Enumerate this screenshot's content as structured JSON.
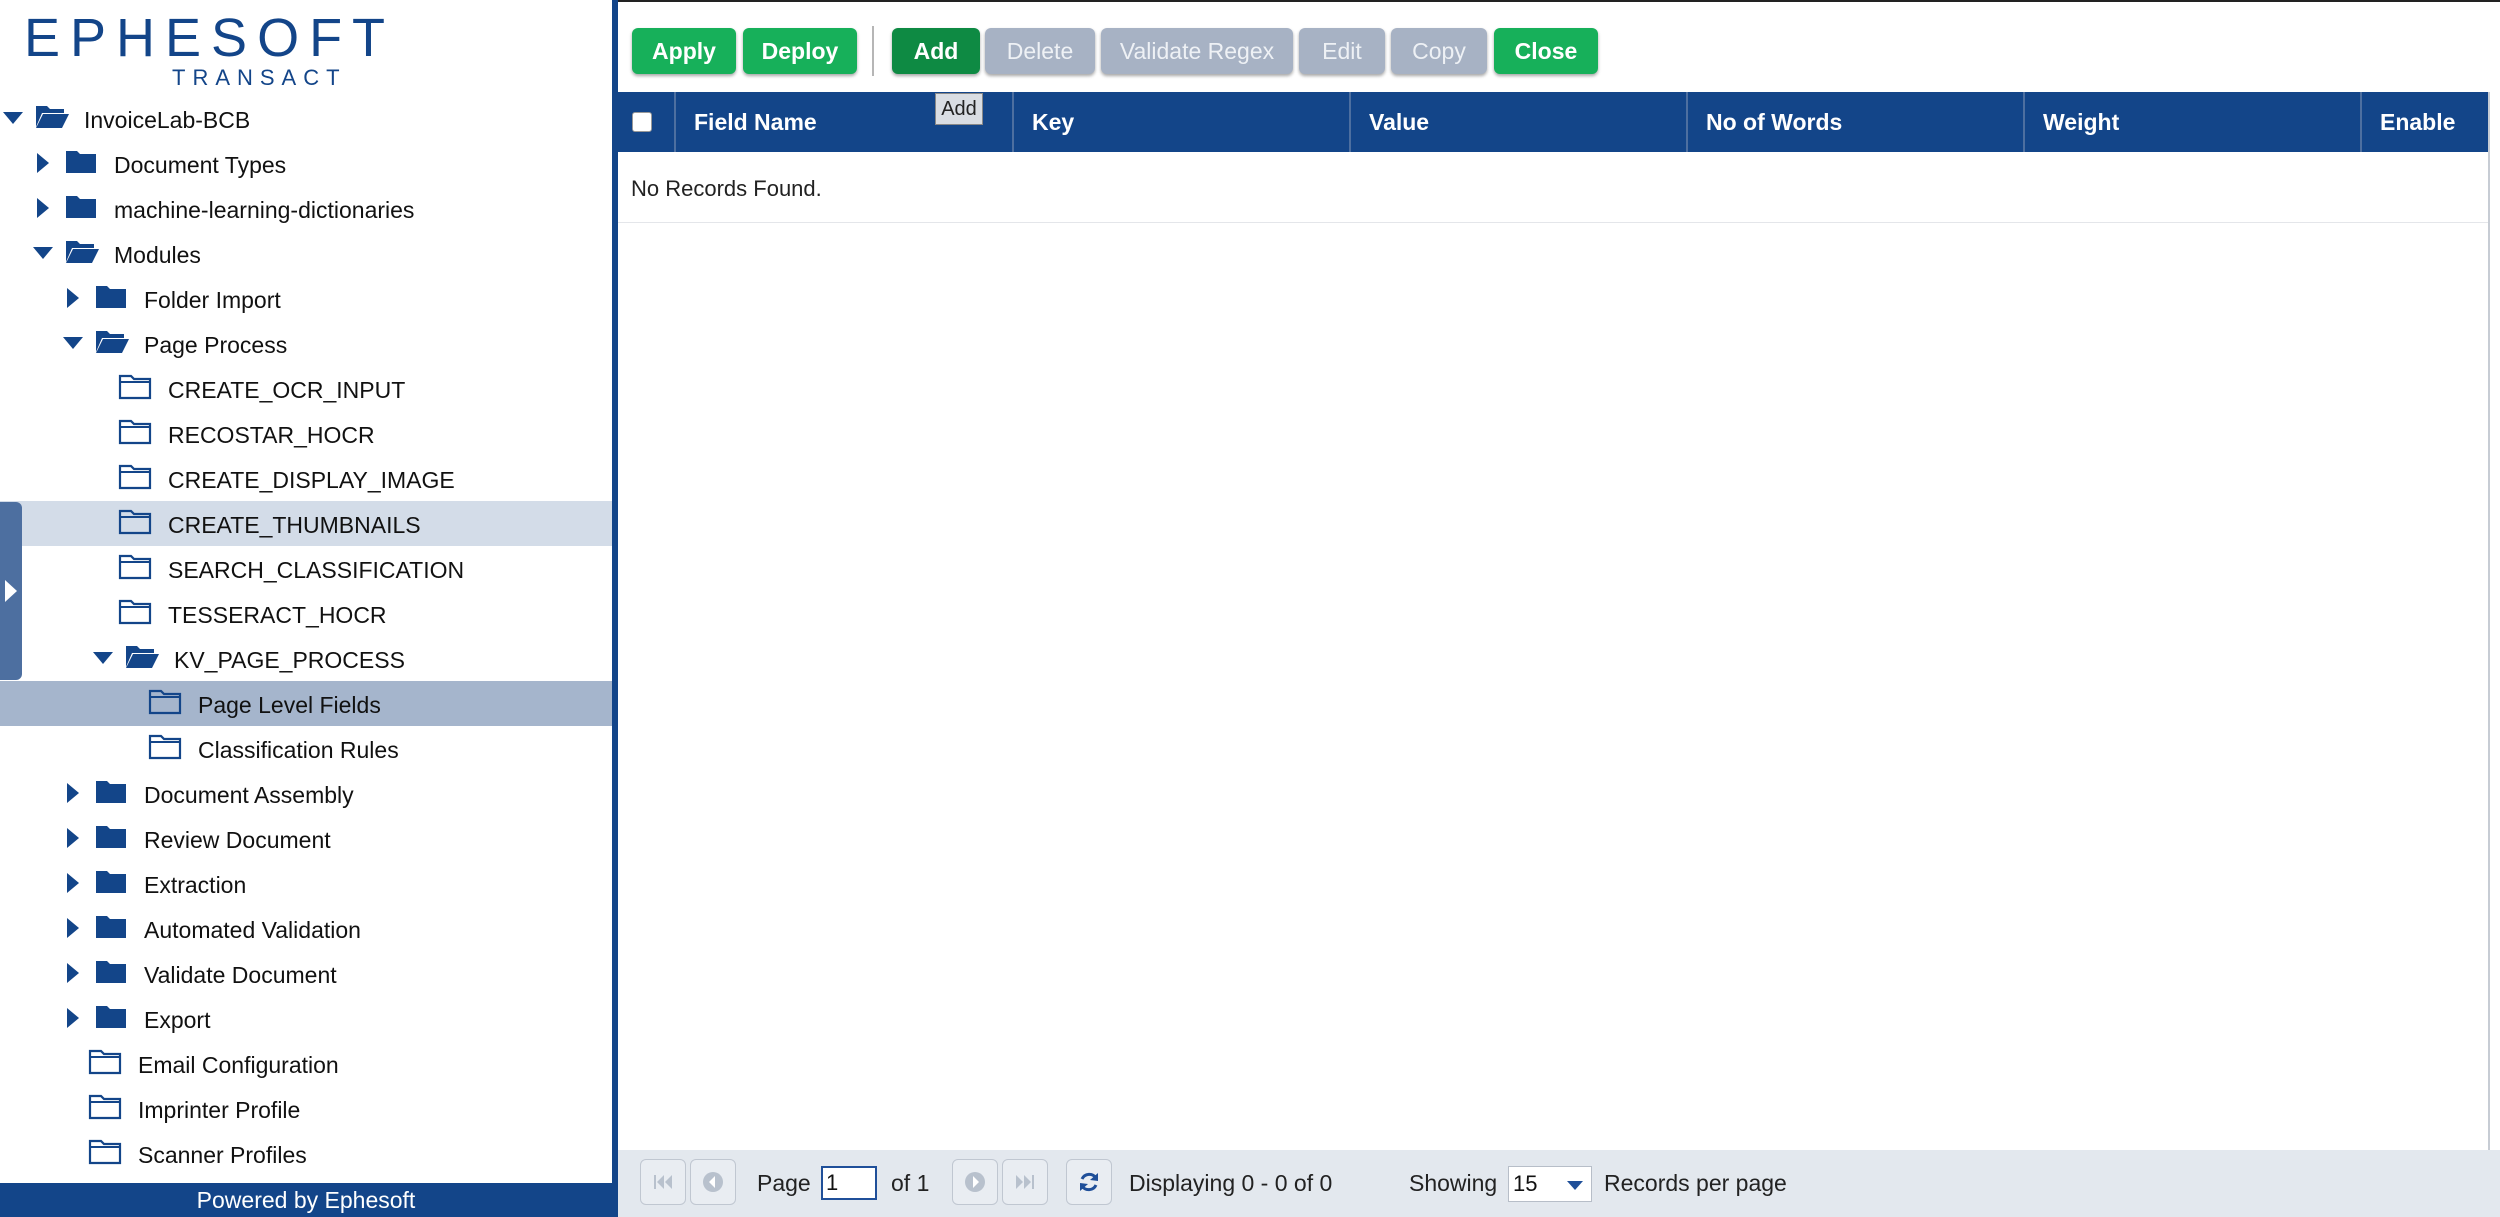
{
  "logo": {
    "main": "EPHESOFT",
    "sub": "TRANSACT"
  },
  "tree": [
    {
      "label": "InvoiceLab-BCB",
      "level": 0,
      "toggle": "open",
      "folder": "open-solid",
      "state": ""
    },
    {
      "label": "Document Types",
      "level": 1,
      "toggle": "closed",
      "folder": "solid",
      "state": ""
    },
    {
      "label": "machine-learning-dictionaries",
      "level": 1,
      "toggle": "closed",
      "folder": "solid",
      "state": ""
    },
    {
      "label": "Modules",
      "level": 1,
      "toggle": "open",
      "folder": "open-solid",
      "state": ""
    },
    {
      "label": "Folder Import",
      "level": 2,
      "toggle": "closed",
      "folder": "solid",
      "state": ""
    },
    {
      "label": "Page Process",
      "level": 2,
      "toggle": "open",
      "folder": "open-solid",
      "state": ""
    },
    {
      "label": "CREATE_OCR_INPUT",
      "level": 3,
      "toggle": "none",
      "folder": "outline",
      "state": ""
    },
    {
      "label": "RECOSTAR_HOCR",
      "level": 3,
      "toggle": "none",
      "folder": "outline",
      "state": ""
    },
    {
      "label": "CREATE_DISPLAY_IMAGE",
      "level": 3,
      "toggle": "none",
      "folder": "outline",
      "state": ""
    },
    {
      "label": "CREATE_THUMBNAILS",
      "level": 3,
      "toggle": "none",
      "folder": "outline",
      "state": "hover"
    },
    {
      "label": "SEARCH_CLASSIFICATION",
      "level": 3,
      "toggle": "none",
      "folder": "outline",
      "state": ""
    },
    {
      "label": "TESSERACT_HOCR",
      "level": 3,
      "toggle": "none",
      "folder": "outline",
      "state": ""
    },
    {
      "label": "KV_PAGE_PROCESS",
      "level": 3,
      "toggle": "open",
      "folder": "open-solid",
      "state": ""
    },
    {
      "label": "Page Level Fields",
      "level": 4,
      "toggle": "none",
      "folder": "outline",
      "state": "selected"
    },
    {
      "label": "Classification Rules",
      "level": 4,
      "toggle": "none",
      "folder": "outline",
      "state": ""
    },
    {
      "label": "Document Assembly",
      "level": 2,
      "toggle": "closed",
      "folder": "solid",
      "state": ""
    },
    {
      "label": "Review Document",
      "level": 2,
      "toggle": "closed",
      "folder": "solid",
      "state": ""
    },
    {
      "label": "Extraction",
      "level": 2,
      "toggle": "closed",
      "folder": "solid",
      "state": ""
    },
    {
      "label": "Automated Validation",
      "level": 2,
      "toggle": "closed",
      "folder": "solid",
      "state": ""
    },
    {
      "label": "Validate Document",
      "level": 2,
      "toggle": "closed",
      "folder": "solid",
      "state": ""
    },
    {
      "label": "Export",
      "level": 2,
      "toggle": "closed",
      "folder": "solid",
      "state": ""
    },
    {
      "label": "Email Configuration",
      "level": 2,
      "toggle": "none",
      "folder": "outline",
      "state": ""
    },
    {
      "label": "Imprinter Profile",
      "level": 2,
      "toggle": "none",
      "folder": "outline",
      "state": ""
    },
    {
      "label": "Scanner Profiles",
      "level": 2,
      "toggle": "none",
      "folder": "outline",
      "state": ""
    }
  ],
  "footer": {
    "text": "Powered by Ephesoft"
  },
  "toolbar": {
    "apply": "Apply",
    "deploy": "Deploy",
    "add": "Add",
    "delete": "Delete",
    "validate_regex": "Validate Regex",
    "edit": "Edit",
    "copy": "Copy",
    "close": "Close",
    "tooltip": "Add"
  },
  "grid": {
    "columns": [
      "Field Name",
      "Key",
      "Value",
      "No of Words",
      "Weight",
      "Enable"
    ],
    "empty_message": "No Records Found."
  },
  "pager": {
    "page_label": "Page",
    "page_value": "1",
    "of_label": "of 1",
    "displaying": "Displaying 0 - 0 of 0",
    "showing_label": "Showing",
    "per_page_value": "15",
    "records_per_page": "Records per page"
  },
  "colors": {
    "brand_blue": "#134589",
    "green": "#17b05a",
    "dark_green": "#0e8a43",
    "disabled": "#a7b2c4"
  }
}
